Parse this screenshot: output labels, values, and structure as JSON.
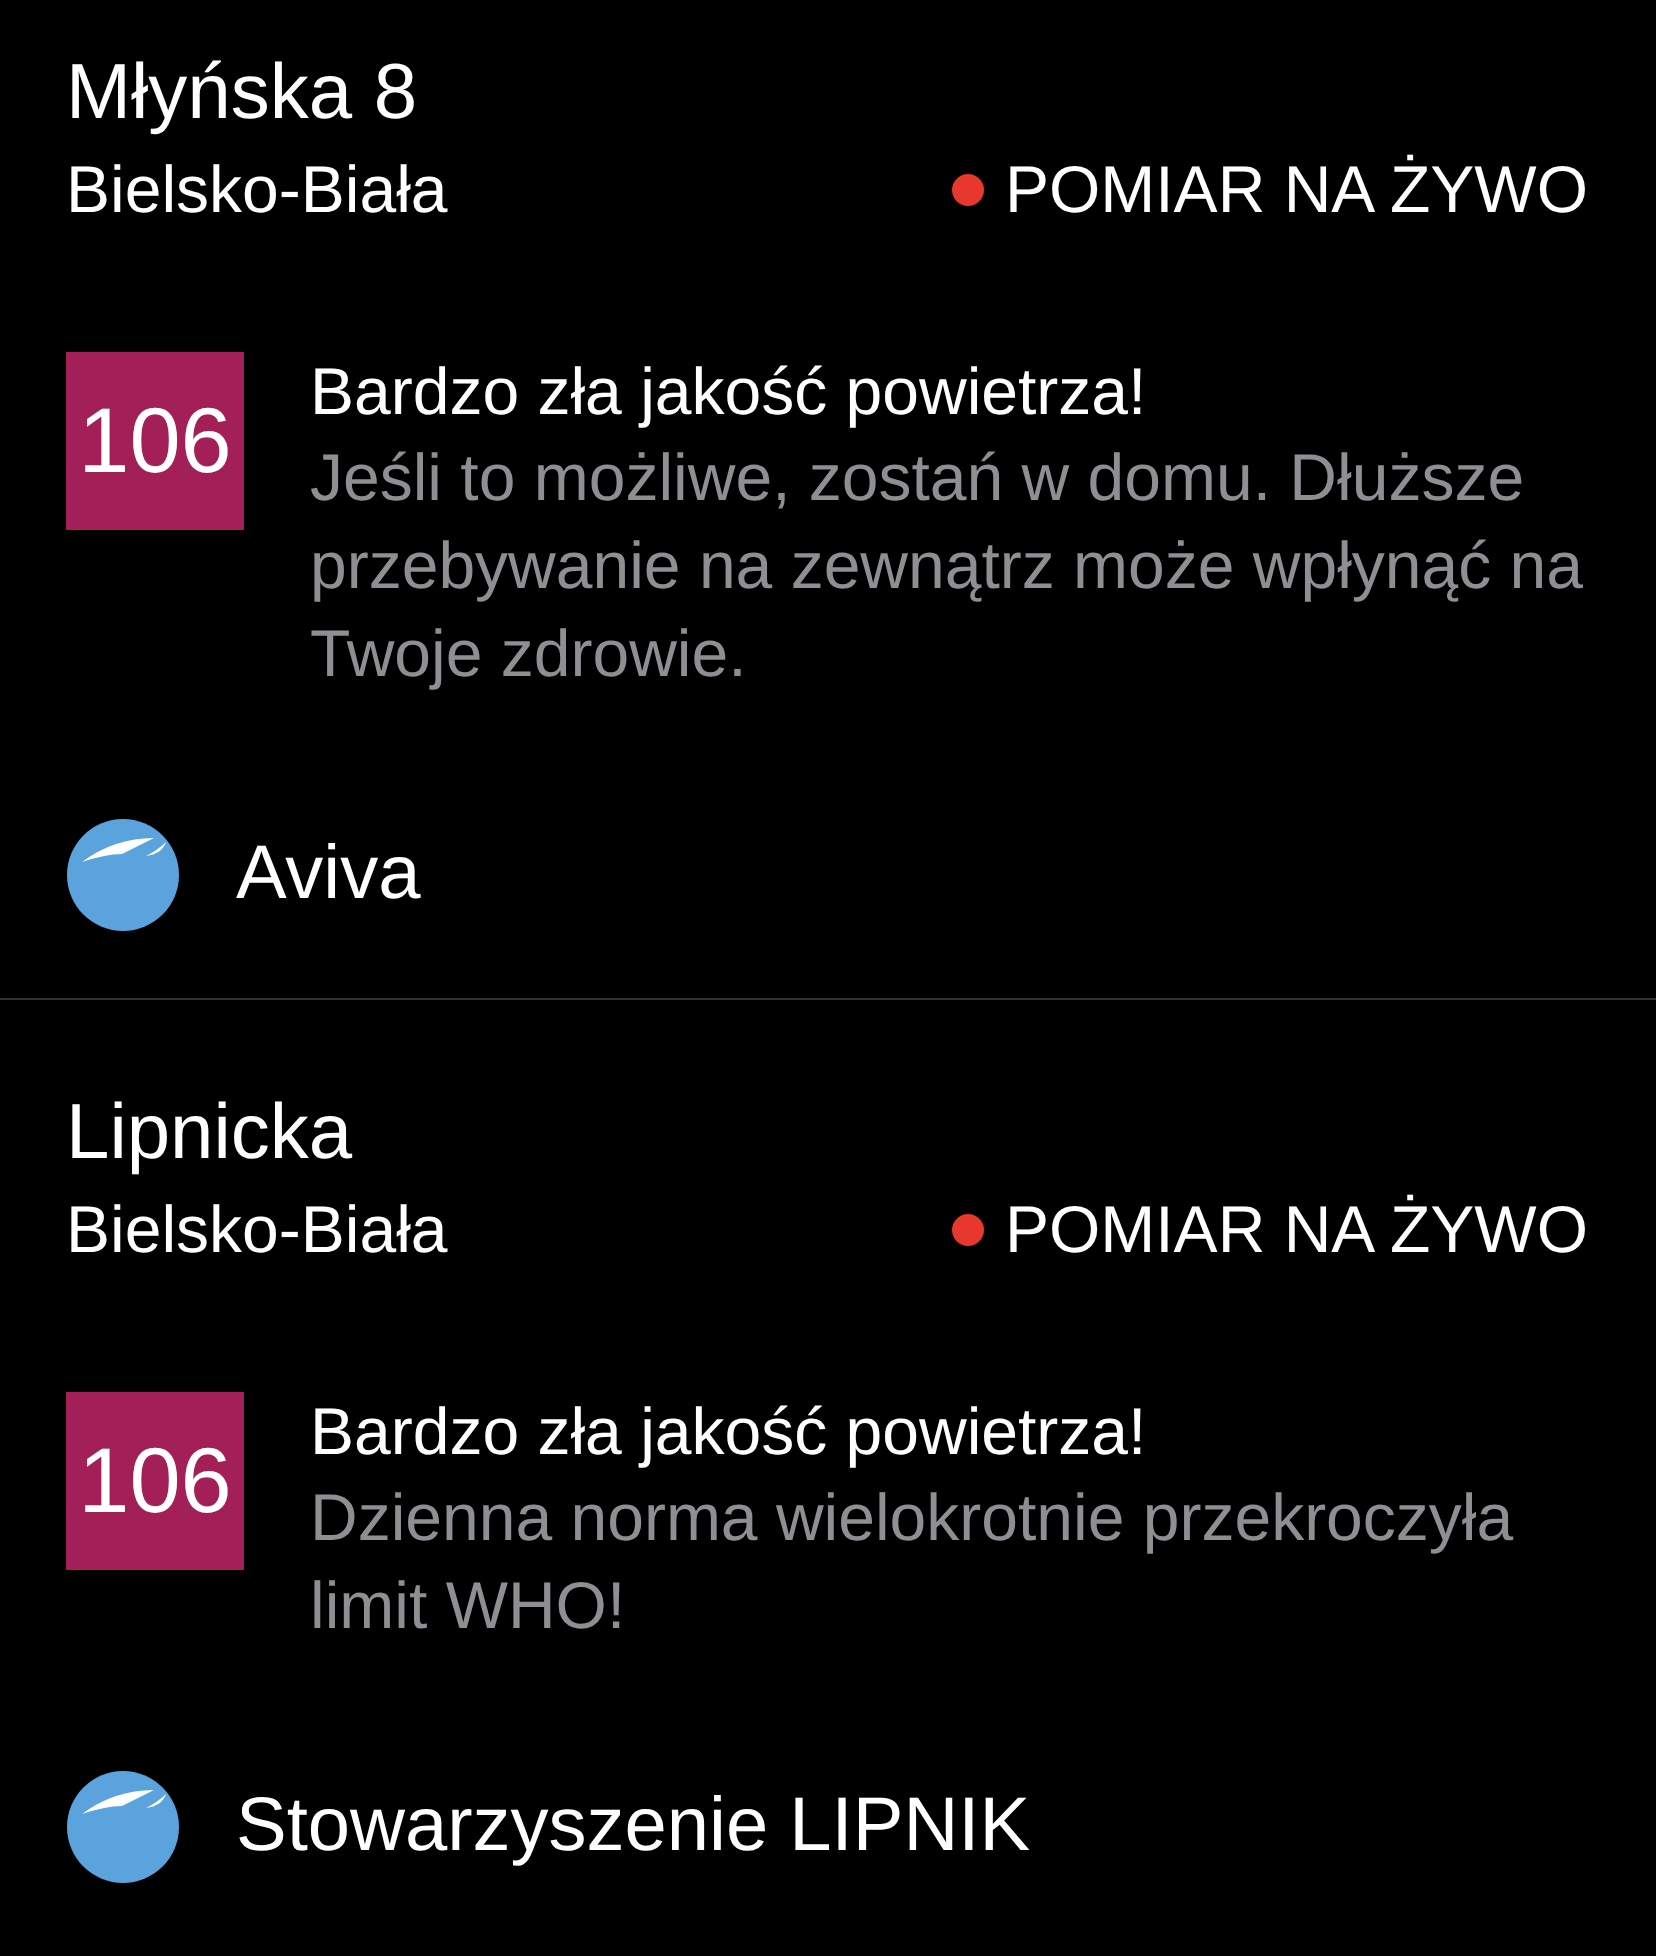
{
  "stations": [
    {
      "name": "Młyńska 8",
      "city": "Bielsko-Biała",
      "live_label": "POMIAR NA ŻYWO",
      "index_value": "106",
      "headline": "Bardzo zła jakość powietrza!",
      "advice": "Jeśli to możliwe, zostań w domu. Dłuższe przebywanie na zewnątrz może wpłynąć na Twoje zdrowie.",
      "provider": "Aviva"
    },
    {
      "name": "Lipnicka",
      "city": "Bielsko-Biała",
      "live_label": "POMIAR NA ŻYWO",
      "index_value": "106",
      "headline": "Bardzo zła jakość powietrza!",
      "advice": "Dzienna norma wielokrotnie przekroczyła limit WHO!",
      "provider": "Stowarzyszenie LIPNIK"
    }
  ]
}
